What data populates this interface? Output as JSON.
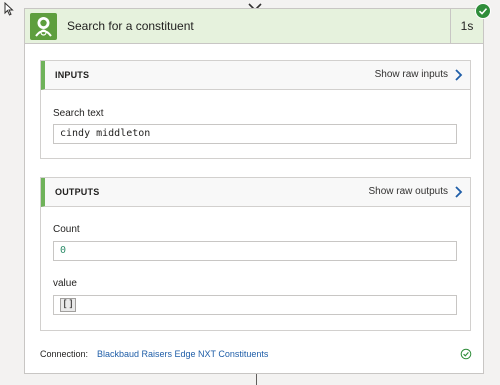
{
  "action": {
    "title": "Search for a constituent",
    "duration": "1s",
    "status": "succeeded",
    "icon": "constituent-person-icon"
  },
  "inputs": {
    "header": "INPUTS",
    "raw_link": "Show raw inputs",
    "fields": [
      {
        "label": "Search text",
        "value": "cindy middleton"
      }
    ]
  },
  "outputs": {
    "header": "OUTPUTS",
    "raw_link": "Show raw outputs",
    "fields": [
      {
        "label": "Count",
        "value": "0"
      },
      {
        "label": "value",
        "value": "[]"
      }
    ]
  },
  "connection": {
    "label": "Connection:",
    "name": "Blackbaud Raisers Edge NXT Constituents"
  },
  "colors": {
    "header_bg": "#e6f2dd",
    "accent_green": "#6fb25a",
    "success": "#2f8d3a",
    "link": "#1f5ea8"
  }
}
